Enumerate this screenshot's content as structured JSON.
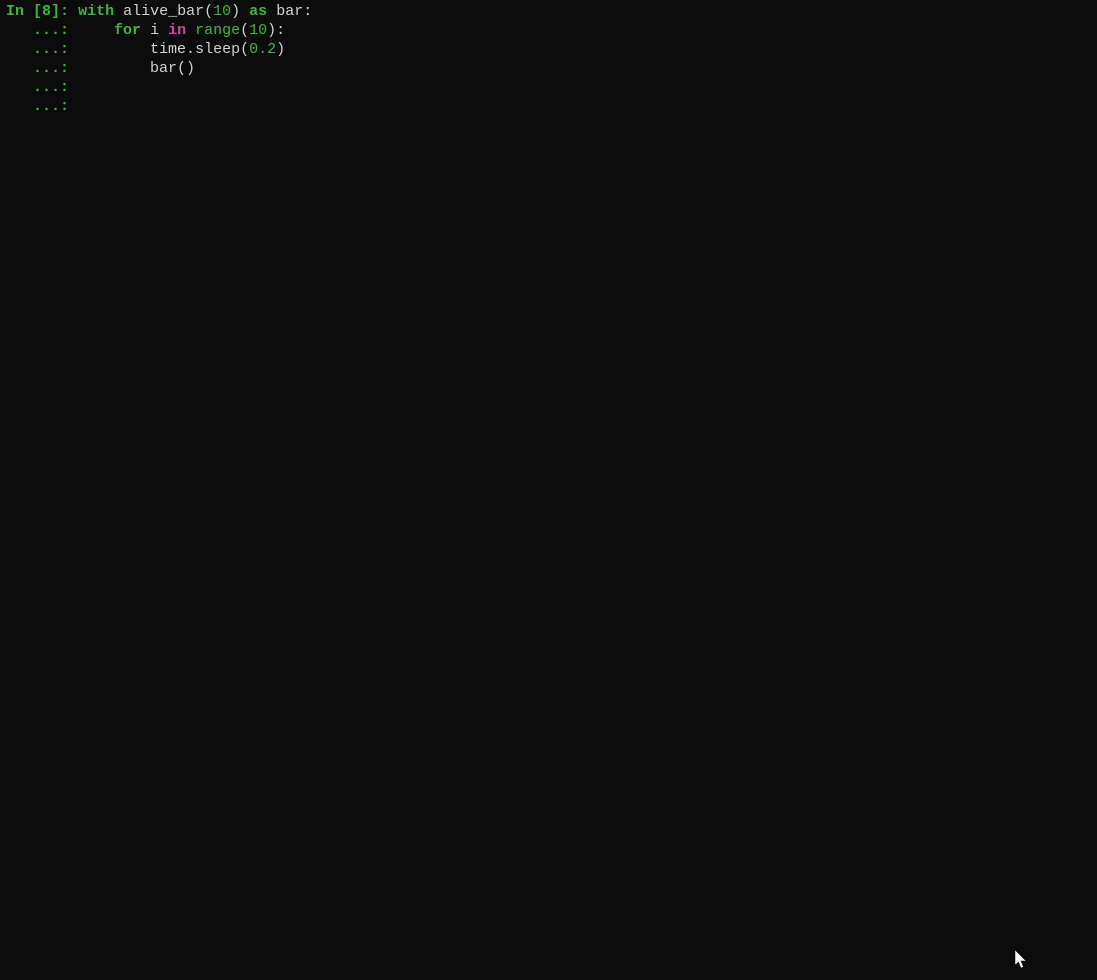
{
  "terminal": {
    "prompt": {
      "in_label": "In ",
      "open_bracket": "[",
      "index": "8",
      "close_bracket": "]: ",
      "continuation": "   ...: "
    },
    "code": {
      "line1": {
        "kw_with": "with",
        "sp1": " ",
        "fn_alive_bar": "alive_bar",
        "lparen": "(",
        "num_10": "10",
        "rparen": ")",
        "sp2": " ",
        "kw_as": "as",
        "sp3": " ",
        "id_bar": "bar",
        "colon": ":"
      },
      "line2": {
        "indent": "    ",
        "kw_for": "for",
        "sp1": " ",
        "id_i": "i",
        "sp2": " ",
        "kw_in": "in",
        "sp3": " ",
        "fn_range": "range",
        "lparen": "(",
        "num_10": "10",
        "rparen_colon": "):"
      },
      "line3": {
        "indent": "        ",
        "id_time": "time",
        "dot": ".",
        "id_sleep": "sleep",
        "lparen": "(",
        "num_02": "0.2",
        "rparen": ")"
      },
      "line4": {
        "indent": "        ",
        "id_bar": "bar",
        "parens": "()"
      }
    }
  }
}
